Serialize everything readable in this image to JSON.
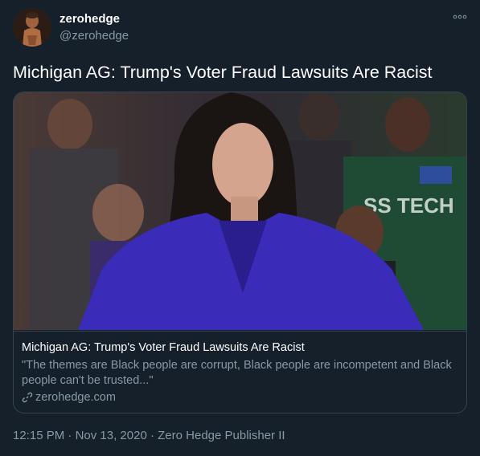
{
  "tweet": {
    "display_name": "zerohedge",
    "handle": "@zerohedge",
    "text": "Michigan AG: Trump's Voter Fraud Lawsuits Are Racist",
    "more_icon": "more-dots-icon",
    "card": {
      "image_icon": "article-photo",
      "title": "Michigan AG: Trump's Voter Fraud Lawsuits Are Racist",
      "description": "\"The themes are Black people are corrupt, Black people are incompetent and Black people can't be trusted...\"",
      "domain": "zerohedge.com",
      "domain_icon": "link-icon"
    },
    "time": "12:15 PM",
    "separator": " · ",
    "date": "Nov 13, 2020",
    "source": "Zero Hedge Publisher II"
  },
  "colors": {
    "background": "#15202b",
    "text_primary": "#ffffff",
    "text_secondary": "#8899a6",
    "border": "#38444d",
    "blazer_blue": "#3a2bb8"
  }
}
